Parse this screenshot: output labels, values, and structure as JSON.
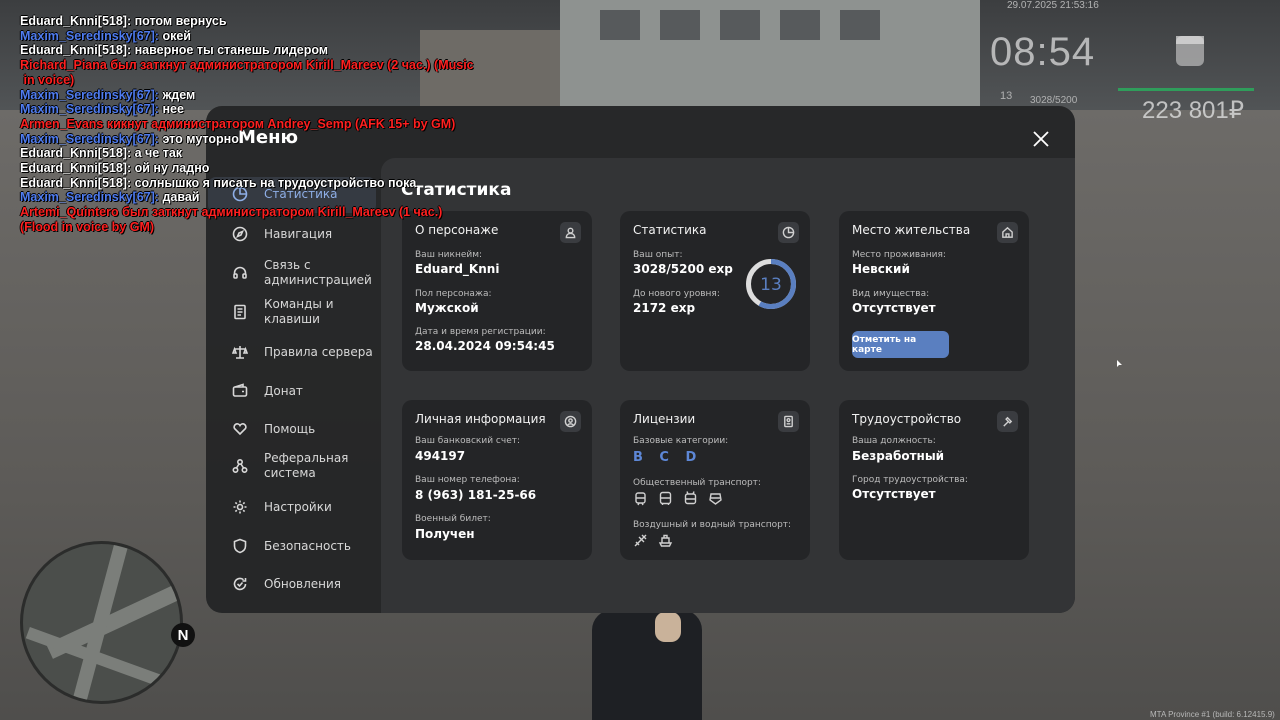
{
  "chat": [
    {
      "text": "Eduard_Knni[518]: потом вернусь",
      "color": "#ffffff"
    },
    {
      "text": "Maxim_Seredinsky[67]: ",
      "tail": "окей",
      "color": "#4f7cf0"
    },
    {
      "text": "Eduard_Knni[518]: наверное ты станешь лидером",
      "color": "#ffffff"
    },
    {
      "text": "Richard_Piana был заткнут администратором Kirill_Mareev (2 час.) (Music",
      "color": "#ff2020"
    },
    {
      "text": " in voice)",
      "color": "#ff2020"
    },
    {
      "text": "Maxim_Seredinsky[67]: ",
      "tail": "ждем",
      "color": "#4f7cf0"
    },
    {
      "text": "Maxim_Seredinsky[67]: ",
      "tail": "нее",
      "color": "#4f7cf0"
    },
    {
      "text": "Armen_Evans кикнут администратором Andrey_Semp (AFK 15+ by GM)",
      "color": "#ff2020"
    },
    {
      "text": "Maxim_Seredinsky[67]: ",
      "tail": "это муторно",
      "color": "#4f7cf0"
    },
    {
      "text": "Eduard_Knni[518]: а че так",
      "color": "#ffffff"
    },
    {
      "text": "Eduard_Knni[518]: ой ну ладно",
      "color": "#ffffff"
    },
    {
      "text": "Eduard_Knni[518]: солнышко я писать на трудоустройство пока",
      "color": "#ffffff"
    },
    {
      "text": "Maxim_Seredinsky[67]: ",
      "tail": "давай",
      "color": "#4f7cf0"
    },
    {
      "text": "Artemi_Quintero был заткнут администратором Kirill_Mareev (1 час.)",
      "color": "#ff2020"
    },
    {
      "text": "(Flood in voice by GM)",
      "color": "#ff2020"
    }
  ],
  "hud": {
    "date": "29.07.2025 21:53:16",
    "time": "08:54",
    "level": "13",
    "exp": "3028/5200",
    "money": "223 801₽",
    "build": "MTA Province #1 (build: 6.12415.9)",
    "compass": "N"
  },
  "menu": {
    "title": "Меню",
    "nav": [
      {
        "label": "Статистика",
        "icon": "pie-chart-icon"
      },
      {
        "label": "Навигация",
        "icon": "compass-icon"
      },
      {
        "label": "Связь с администрацией",
        "icon": "headset-icon"
      },
      {
        "label": "Команды и клавиши",
        "icon": "document-icon"
      },
      {
        "label": "Правила сервера",
        "icon": "scales-icon"
      },
      {
        "label": "Донат",
        "icon": "wallet-icon"
      },
      {
        "label": "Помощь",
        "icon": "heart-hand-icon"
      },
      {
        "label": "Реферальная система",
        "icon": "network-icon"
      },
      {
        "label": "Настройки",
        "icon": "gear-icon"
      },
      {
        "label": "Безопасность",
        "icon": "shield-icon"
      },
      {
        "label": "Обновления",
        "icon": "refresh-check-icon"
      }
    ],
    "content_title": "Статистика",
    "cards": {
      "character": {
        "title": "О персонаже",
        "nickname_label": "Ваш никнейм:",
        "nickname": "Eduard_Knni",
        "gender_label": "Пол персонажа:",
        "gender": "Мужской",
        "reg_label": "Дата и время регистрации:",
        "reg": "28.04.2024 09:54:45"
      },
      "stats": {
        "title": "Статистика",
        "exp_label": "Ваш опыт:",
        "exp": "3028/5200 exp",
        "next_label": "До нового уровня:",
        "next": "2172 exp",
        "level": "13",
        "progress": 0.582
      },
      "residence": {
        "title": "Место жительства",
        "place_label": "Место проживания:",
        "place": "Невский",
        "property_label": "Вид имущества:",
        "property": "Отсутствует",
        "button": "Отметить на карте"
      },
      "personal": {
        "title": "Личная информация",
        "bank_label": "Ваш банковский счет:",
        "bank": "494197",
        "phone_label": "Ваш номер телефона:",
        "phone": "8 (963) 181-25-66",
        "military_label": "Военный билет:",
        "military": "Получен"
      },
      "licenses": {
        "title": "Лицензии",
        "base_label": "Базовые категории:",
        "base": "B C D",
        "public_label": "Общественный транспорт:",
        "air_label": "Воздушный и водный транспорт:"
      },
      "job": {
        "title": "Трудоустройство",
        "position_label": "Ваша должность:",
        "position": "Безработный",
        "city_label": "Город трудоустройства:",
        "city": "Отсутствует"
      }
    }
  }
}
